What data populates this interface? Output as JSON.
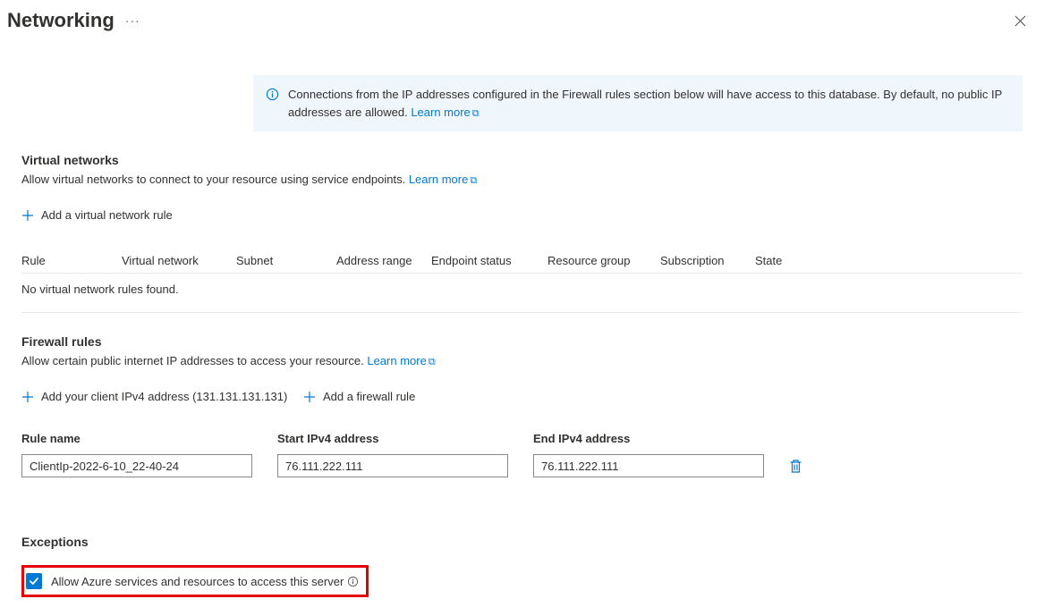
{
  "header": {
    "title": "Networking"
  },
  "info_banner": {
    "text_a": "Connections from the IP addresses configured in the Firewall rules section below will have access to this database. By default, no public IP addresses are allowed.  ",
    "learn_more": "Learn more"
  },
  "virtual_networks": {
    "heading": "Virtual networks",
    "desc": "Allow virtual networks to connect to your resource using service endpoints. ",
    "learn_more": "Learn more",
    "add_rule_label": "Add a virtual network rule",
    "columns": {
      "rule": "Rule",
      "vnet": "Virtual network",
      "subnet": "Subnet",
      "addr": "Address range",
      "endpoint": "Endpoint status",
      "rg": "Resource group",
      "sub": "Subscription",
      "state": "State"
    },
    "empty": "No virtual network rules found."
  },
  "firewall": {
    "heading": "Firewall rules",
    "desc": "Allow certain public internet IP addresses to access your resource. ",
    "learn_more": "Learn more",
    "add_client_label": "Add your client IPv4 address (131.131.131.131)",
    "add_rule_label": "Add a firewall rule",
    "cols": {
      "name": "Rule name",
      "start": "Start IPv4 address",
      "end": "End IPv4 address"
    },
    "rows": [
      {
        "name": "ClientIp-2022-6-10_22-40-24",
        "start": "76.111.222.111",
        "end": "76.111.222.111"
      }
    ]
  },
  "exceptions": {
    "heading": "Exceptions",
    "allow_label": "Allow Azure services and resources to access this server"
  }
}
